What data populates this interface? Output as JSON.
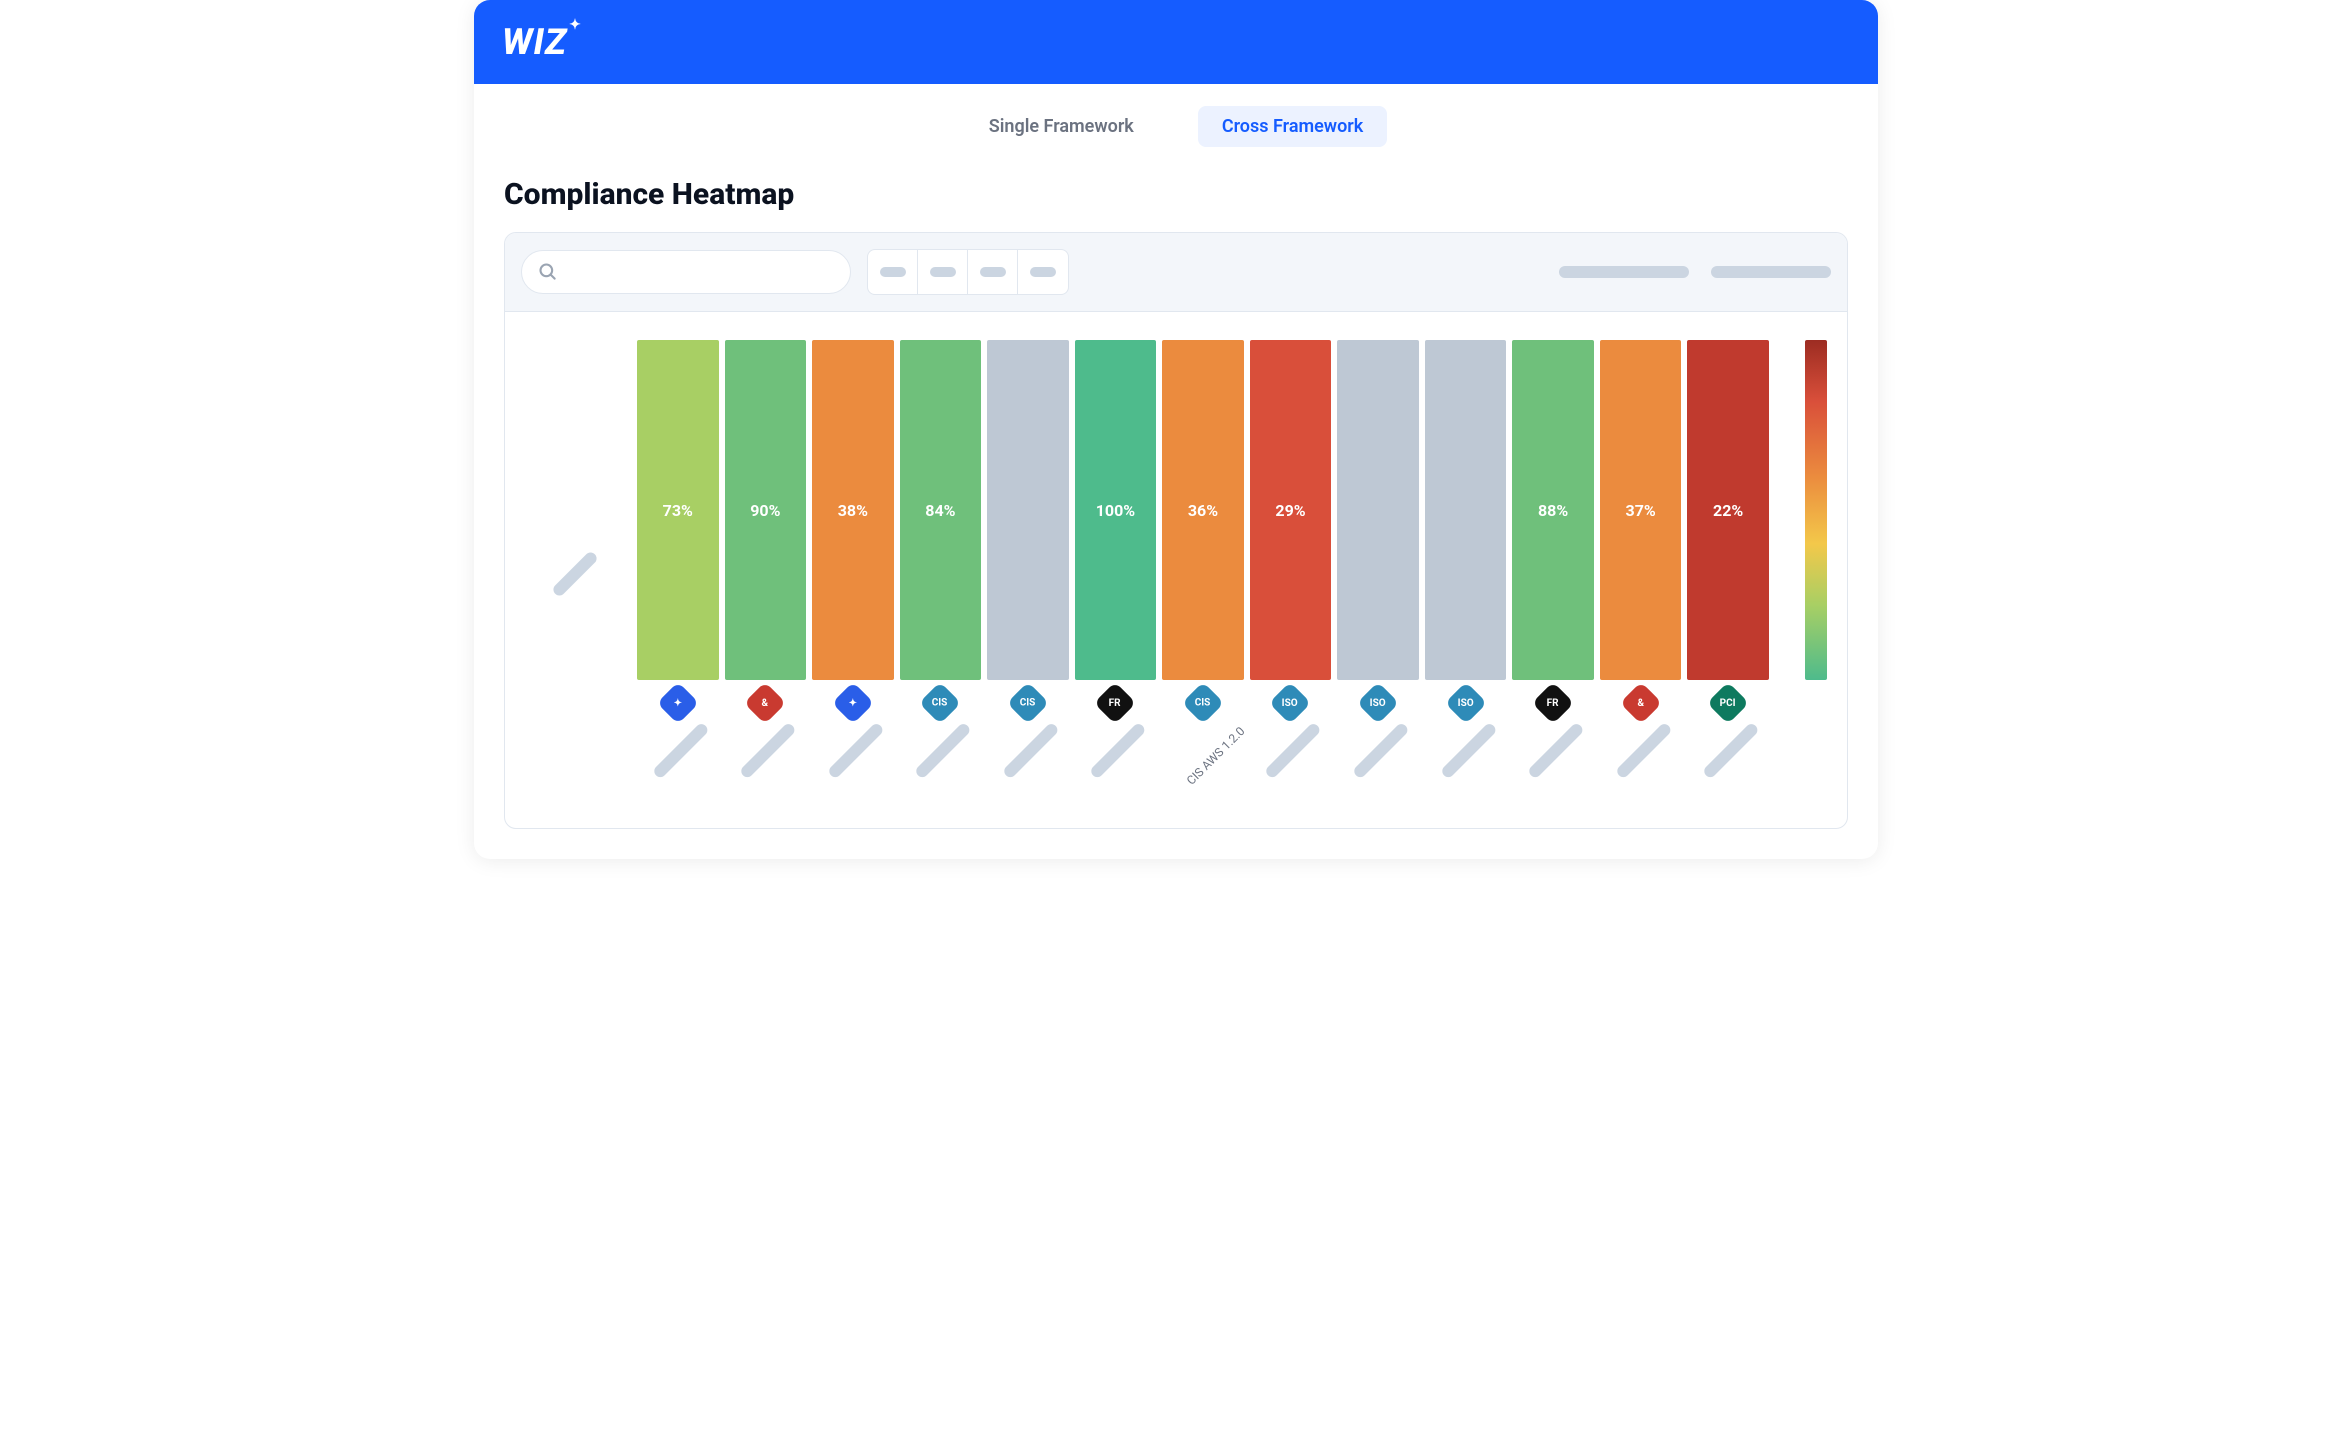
{
  "brand": {
    "name": "WIZ"
  },
  "tabs": {
    "single": "Single Framework",
    "cross": "Cross Framework",
    "active": "cross"
  },
  "title": "Compliance Heatmap",
  "search": {
    "placeholder": ""
  },
  "colors": {
    "accent": "#155CFF",
    "gray": "#BEC8D4",
    "heat": {
      "green": "#4EBB8C",
      "lightgreen": "#6FC07B",
      "lime": "#A8CF64",
      "orange": "#EB8B3E",
      "redorange": "#D94F3A",
      "red": "#C03A2E"
    }
  },
  "chart_data": {
    "type": "heatmap",
    "title": "Compliance Heatmap",
    "xlabel": "",
    "ylabel": "",
    "ylim": [
      0,
      100
    ],
    "categories": [
      {
        "icon": "star-blue",
        "label": ""
      },
      {
        "icon": "amp-red",
        "label": ""
      },
      {
        "icon": "star-blue",
        "label": ""
      },
      {
        "icon": "cis-blue",
        "label": ""
      },
      {
        "icon": "cis-blue",
        "label": ""
      },
      {
        "icon": "fr-black",
        "label": ""
      },
      {
        "icon": "cis-blue",
        "label": "CIS AWS 1.2.0"
      },
      {
        "icon": "iso-blue",
        "label": ""
      },
      {
        "icon": "iso-blue",
        "label": ""
      },
      {
        "icon": "iso-blue",
        "label": ""
      },
      {
        "icon": "fr-black",
        "label": ""
      },
      {
        "icon": "amp-red",
        "label": ""
      },
      {
        "icon": "pci-green",
        "label": ""
      }
    ],
    "values": [
      73,
      90,
      38,
      84,
      null,
      100,
      36,
      29,
      null,
      null,
      88,
      37,
      22
    ],
    "display": [
      "73%",
      "90%",
      "38%",
      "84%",
      "",
      "100%",
      "36%",
      "29%",
      "",
      "",
      "88%",
      "37%",
      "22%"
    ],
    "cell_colors": [
      "#A8CF64",
      "#6FC07B",
      "#EB8B3E",
      "#6FC07B",
      "#BEC8D4",
      "#4EBB8C",
      "#EB8B3E",
      "#D94F3A",
      "#BEC8D4",
      "#BEC8D4",
      "#6FC07B",
      "#EB8B3E",
      "#C03A2E"
    ]
  },
  "icon_styles": {
    "star-blue": {
      "bg": "#2A5EE8",
      "txt": "✦"
    },
    "amp-red": {
      "bg": "#C93A30",
      "txt": "&"
    },
    "cis-blue": {
      "bg": "#2E8BB8",
      "txt": "CIS"
    },
    "fr-black": {
      "bg": "#111111",
      "txt": "FR"
    },
    "iso-blue": {
      "bg": "#2E8BB8",
      "txt": "ISO"
    },
    "pci-green": {
      "bg": "#0E7A5F",
      "txt": "PCI"
    }
  }
}
